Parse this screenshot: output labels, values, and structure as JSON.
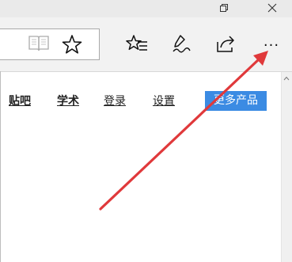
{
  "window_controls": {
    "restore_icon": "restore-icon",
    "close_icon": "close-icon"
  },
  "toolbar": {
    "reading_view_icon": "book-icon",
    "favorite_icon": "star-icon",
    "hub_icon": "favorites-list-icon",
    "notes_icon": "pen-icon",
    "share_icon": "share-icon",
    "more_label": "···"
  },
  "nav": {
    "links": [
      "贴吧",
      "学术",
      "登录",
      "设置"
    ],
    "more_products": "更多产品"
  },
  "colors": {
    "more_products_bg": "#3b8be3",
    "arrow": "#e0393b"
  }
}
